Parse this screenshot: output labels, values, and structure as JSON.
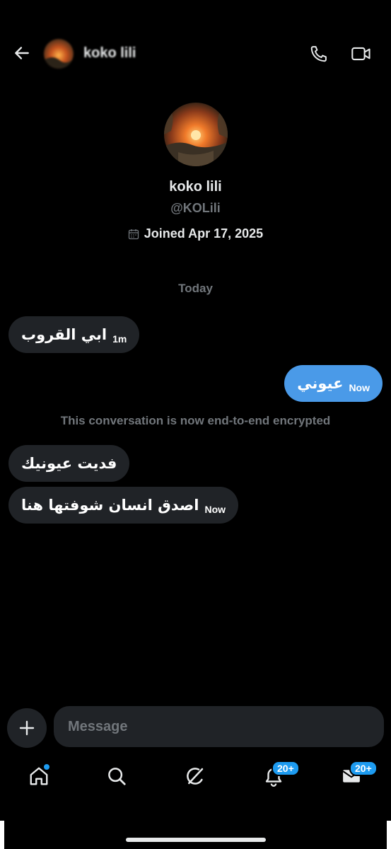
{
  "header": {
    "name": "koko lili",
    "icons": {
      "back": "back-arrow-icon",
      "call": "phone-icon",
      "video": "video-camera-icon"
    }
  },
  "profile": {
    "name": "koko lili",
    "handle": "@KOLili",
    "joined": "Joined Apr 17, 2025",
    "joined_icon": "calendar-icon"
  },
  "conversation": {
    "day_label": "Today",
    "encryption_notice": "This conversation is now end-to-end encrypted",
    "messages": [
      {
        "direction": "in",
        "text": "ابي القروب",
        "time": "1m"
      },
      {
        "direction": "out",
        "text": "عيوني",
        "time": "Now"
      },
      {
        "direction": "in",
        "text": "فديت عيونيك",
        "time": ""
      },
      {
        "direction": "in",
        "text": "اصدق انسان شوفتها هنا",
        "time": "Now"
      }
    ]
  },
  "composer": {
    "placeholder": "Message",
    "add_icon": "plus-icon"
  },
  "tabbar": {
    "items": [
      {
        "name": "home",
        "icon": "home-icon",
        "badge": ""
      },
      {
        "name": "search",
        "icon": "search-icon",
        "badge": ""
      },
      {
        "name": "grok",
        "icon": "grok-icon",
        "badge": ""
      },
      {
        "name": "notifications",
        "icon": "bell-icon",
        "badge": "20+"
      },
      {
        "name": "messages",
        "icon": "mail-icon",
        "badge": "20+"
      }
    ]
  },
  "colors": {
    "background": "#000000",
    "incoming_bubble": "#202327",
    "outgoing_bubble": "#4a9ae8",
    "accent": "#1d9bf0",
    "muted": "#71767b"
  }
}
